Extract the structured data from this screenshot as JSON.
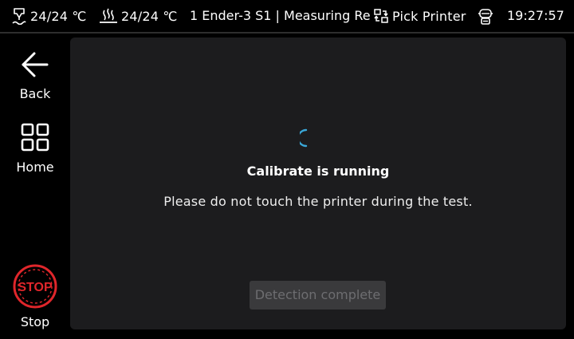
{
  "status_bar": {
    "nozzle_icon": "nozzle-temperature-icon",
    "nozzle_temp": "24/24 ℃",
    "bed_icon": "bed-heat-icon",
    "bed_temp": "24/24 ℃",
    "printer_name": "1 Ender-3 S1 | Measuring Re",
    "pick_icon": "switch-printer-icon",
    "pick_label": "Pick Printer",
    "robot_icon": "robot-icon",
    "time": "19:27:57"
  },
  "nav": {
    "back_label": "Back",
    "back_icon": "arrow-left-icon",
    "home_label": "Home",
    "home_icon": "grid-icon",
    "stop_label": "Stop",
    "stop_icon_text": "STOP",
    "stop_color": "#e0262b"
  },
  "main": {
    "spinner_color": "#3aa7d8",
    "title": "Calibrate is running",
    "message": "Please do not touch the printer during the test.",
    "detect_button_label": "Detection complete",
    "detect_button_enabled": false
  },
  "colors": {
    "background": "#000000",
    "panel": "#1c1c1e",
    "button_disabled_bg": "#3a3a3c",
    "button_disabled_text": "#6d6d70"
  }
}
